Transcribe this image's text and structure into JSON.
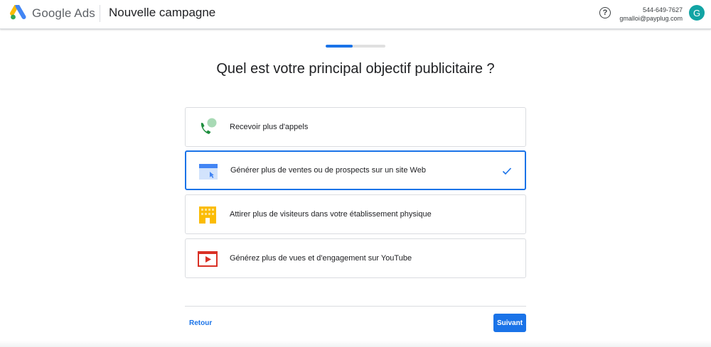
{
  "header": {
    "brand": "Google Ads",
    "page_title": "Nouvelle campagne",
    "help_icon_glyph": "?",
    "account_id": "544-649-7627",
    "account_email": "gmalloi@payplug.com",
    "avatar_initial": "G"
  },
  "progress": {
    "fraction": 0.45
  },
  "question": "Quel est votre principal objectif publicitaire ?",
  "options": [
    {
      "label": "Recevoir plus d'appels",
      "icon": "phone-call-icon",
      "selected": false
    },
    {
      "label": "Générer plus de ventes ou de prospects sur un site Web",
      "icon": "website-icon",
      "selected": true
    },
    {
      "label": "Attirer plus de visiteurs dans votre établissement physique",
      "icon": "store-building-icon",
      "selected": false
    },
    {
      "label": "Générez plus de vues et d'engagement sur YouTube",
      "icon": "youtube-play-icon",
      "selected": false
    }
  ],
  "footer": {
    "back_label": "Retour",
    "next_label": "Suivant"
  },
  "colors": {
    "accent": "#1a73e8",
    "avatar": "#12a4a4",
    "border": "#dadce0"
  }
}
